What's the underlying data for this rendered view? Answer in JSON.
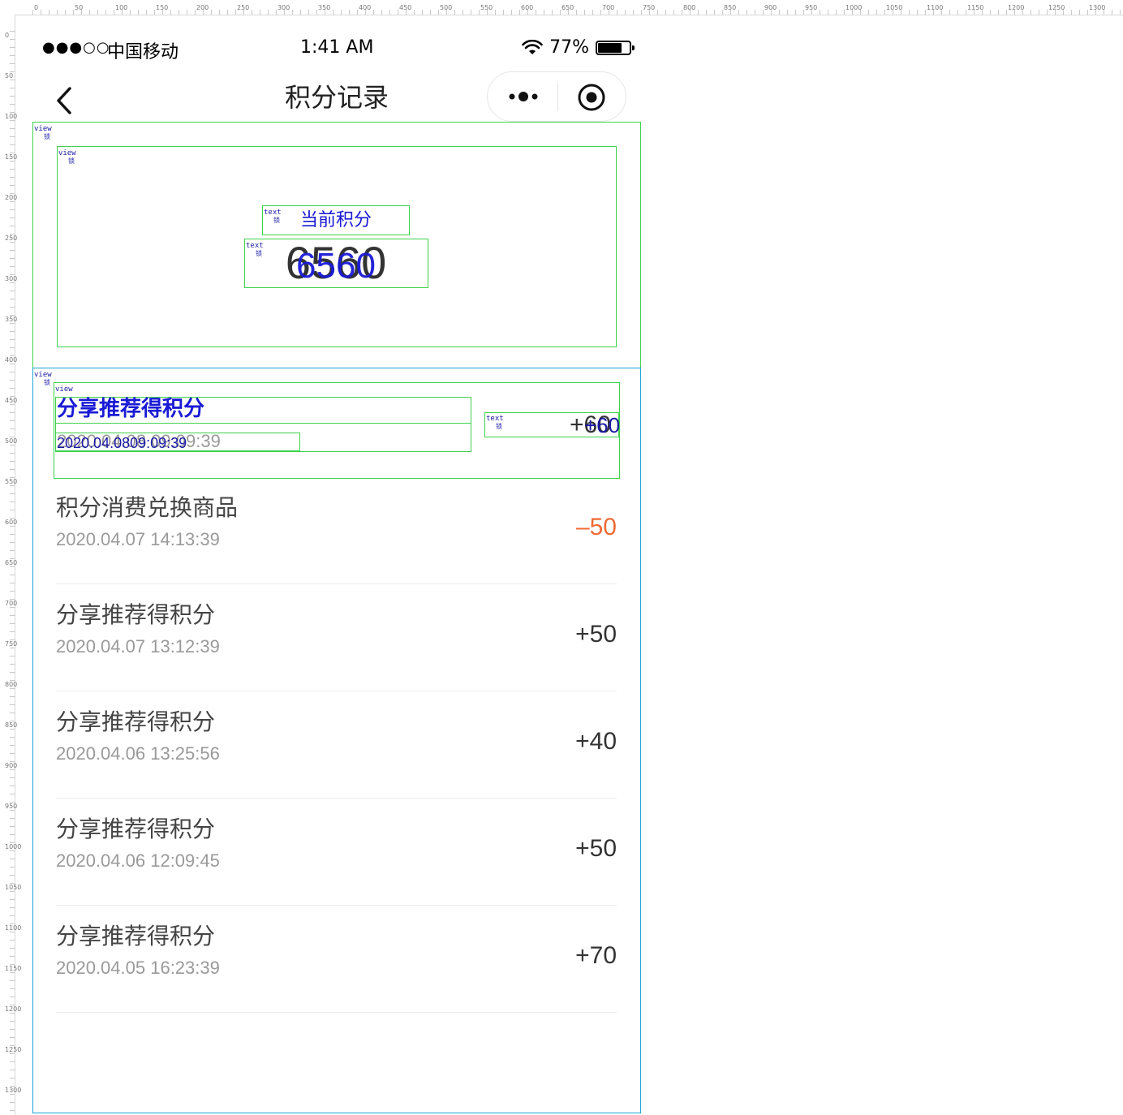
{
  "ruler": {
    "top_labels": [
      "0",
      "50",
      "100",
      "150",
      "200",
      "250",
      "300",
      "350",
      "400",
      "450",
      "500",
      "550",
      "600",
      "650",
      "700",
      "750",
      "800",
      "850",
      "900",
      "950",
      "1000",
      "1050",
      "1100",
      "1150",
      "1200",
      "1250",
      "1300"
    ],
    "left_labels": [
      "0",
      "50",
      "100",
      "150",
      "200",
      "250",
      "300",
      "350",
      "400",
      "450",
      "500",
      "550",
      "600",
      "650",
      "700",
      "750",
      "800",
      "850",
      "900",
      "950",
      "1000",
      "1050",
      "1100",
      "1150",
      "1200",
      "1250",
      "1300"
    ]
  },
  "status_bar": {
    "signal": "●●●○○",
    "carrier": "中国移动",
    "time": "1:41 AM",
    "battery_text": "77%",
    "battery_level": 0.77
  },
  "nav": {
    "title": "积分记录"
  },
  "debug": {
    "view_tag": "view",
    "text_tag": "text",
    "lock_glyph": "锁"
  },
  "summary": {
    "label": "当前积分",
    "value": "6560"
  },
  "records": [
    {
      "title": "分享推荐得积分",
      "time": "2020.04.08 09:09:39",
      "ghost_time": "2020.04.0809:09:39",
      "points": "+60"
    },
    {
      "title": "积分消费兑换商品",
      "time": "2020.04.07 14:13:39",
      "points": "–50"
    },
    {
      "title": "分享推荐得积分",
      "time": "2020.04.07 13:12:39",
      "points": "+50"
    },
    {
      "title": "分享推荐得积分",
      "time": "2020.04.06 13:25:56",
      "points": "+40"
    },
    {
      "title": "分享推荐得积分",
      "time": "2020.04.06 12:09:45",
      "points": "+50"
    },
    {
      "title": "分享推荐得积分",
      "time": "2020.04.05 16:23:39",
      "points": "+70"
    }
  ],
  "colors": {
    "negative": "#f06a35",
    "inspector_green": "#3dd24a",
    "inspector_blue": "#1aa3d9",
    "inspector_text": "#1a1ad6"
  }
}
